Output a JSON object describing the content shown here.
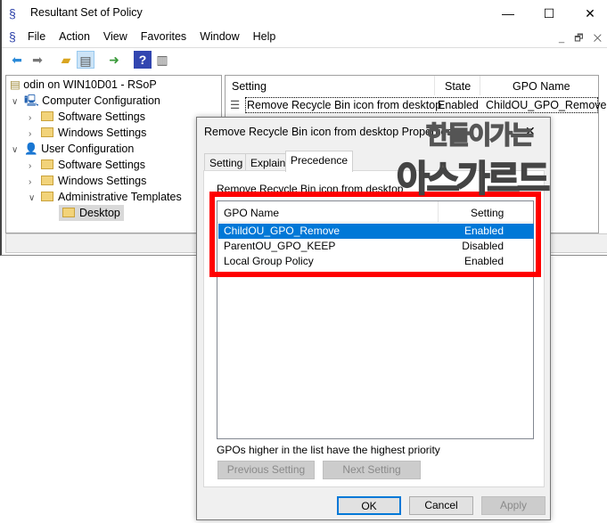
{
  "window": {
    "title": "Resultant Set of Policy",
    "controls": [
      "—",
      "☐",
      "✕"
    ]
  },
  "menu": [
    "File",
    "Action",
    "View",
    "Favorites",
    "Window",
    "Help"
  ],
  "mdi_controls": [
    "_",
    "🗗",
    "✕"
  ],
  "toolbar": [
    "back-icon",
    "forward-icon",
    "up-folder-icon",
    "show-hide-tree-icon",
    "export-list-icon",
    "help-icon",
    "action-pane-icon"
  ],
  "tree": {
    "root": "odin on WIN10D01 - RSoP",
    "items": [
      {
        "label": "Computer Configuration",
        "level": 1,
        "expanded": true
      },
      {
        "label": "Software Settings",
        "level": 2
      },
      {
        "label": "Windows Settings",
        "level": 2
      },
      {
        "label": "User Configuration",
        "level": 1,
        "expanded": true
      },
      {
        "label": "Software Settings",
        "level": 2
      },
      {
        "label": "Windows Settings",
        "level": 2
      },
      {
        "label": "Administrative Templates",
        "level": 2,
        "expanded": true
      },
      {
        "label": "Desktop",
        "level": 3,
        "selected": true
      }
    ]
  },
  "list": {
    "columns": [
      "Setting",
      "State",
      "GPO Name"
    ],
    "rows": [
      {
        "setting": "Remove Recycle Bin icon from desktop",
        "state": "Enabled",
        "gpo": "ChildOU_GPO_Remove"
      }
    ]
  },
  "dialog": {
    "title": "Remove Recycle Bin icon from desktop Properties",
    "close": "✕",
    "tabs": [
      "Setting",
      "Explain",
      "Precedence"
    ],
    "active_tab": "Precedence",
    "label": "Remove Recycle Bin icon from desktop",
    "columns": [
      "GPO Name",
      "Setting"
    ],
    "rows": [
      {
        "name": "ChildOU_GPO_Remove",
        "setting": "Enabled",
        "selected": true
      },
      {
        "name": "ParentOU_GPO_KEEP",
        "setting": "Disabled"
      },
      {
        "name": "Local Group Policy",
        "setting": "Enabled"
      }
    ],
    "note": "GPOs higher in the list have the highest priority",
    "prev": "Previous Setting",
    "next": "Next Setting",
    "ok": "OK",
    "cancel": "Cancel",
    "apply": "Apply"
  },
  "watermark": {
    "line1": "한둘이가는",
    "line2": "아스가르드"
  },
  "colors": {
    "highlight": "#0078d7",
    "annotation": "#ff0000"
  }
}
